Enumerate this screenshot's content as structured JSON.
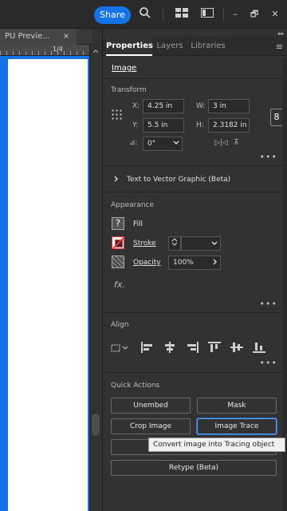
{
  "topbar": {
    "share_label": "Share",
    "icons": [
      "search-icon",
      "arrange-documents-icon",
      "workspace-icon"
    ],
    "window": {
      "minimize": "–",
      "restore": "🗗",
      "close": "✕"
    }
  },
  "document": {
    "tab_title": "PU Previe...",
    "tab_close": "×",
    "ruler_label": "1/4"
  },
  "panel": {
    "collapse": "▸▸",
    "tabs": [
      {
        "label": "Properties",
        "active": true
      },
      {
        "label": "Layers",
        "active": false
      },
      {
        "label": "Libraries",
        "active": false
      }
    ],
    "menu": "≡",
    "selection_type": "Image",
    "transform": {
      "title": "Transform",
      "x_label": "X:",
      "x_value": "4.25 in",
      "y_label": "Y:",
      "y_value": "5.5 in",
      "w_label": "W:",
      "w_value": "3 in",
      "h_label": "H:",
      "h_value": "2.3182 in",
      "angle_label": "⊿:",
      "angle_value": "0°",
      "link_icon": "8",
      "flip_h": "▷|◁",
      "flip_v": "⊼"
    },
    "text_to_vector": "Text to Vector Graphic (Beta)",
    "appearance": {
      "title": "Appearance",
      "fill_label": "Fill",
      "stroke_label": "Stroke",
      "opacity_label": "Opacity",
      "opacity_value": "100%",
      "fx_label": "fx."
    },
    "align": {
      "title": "Align"
    },
    "quick_actions": {
      "title": "Quick Actions",
      "unembed": "Unembed",
      "mask": "Mask",
      "crop_image": "Crop Image",
      "image_trace": "Image Trace",
      "retype": "Retype (Beta)"
    },
    "tooltip": "Convert image into Tracing object",
    "more": "•••"
  },
  "colors": {
    "accent": "#1473e6",
    "panel_bg": "#323232",
    "canvas": "#ffffff",
    "stroke_red": "#e33333"
  }
}
